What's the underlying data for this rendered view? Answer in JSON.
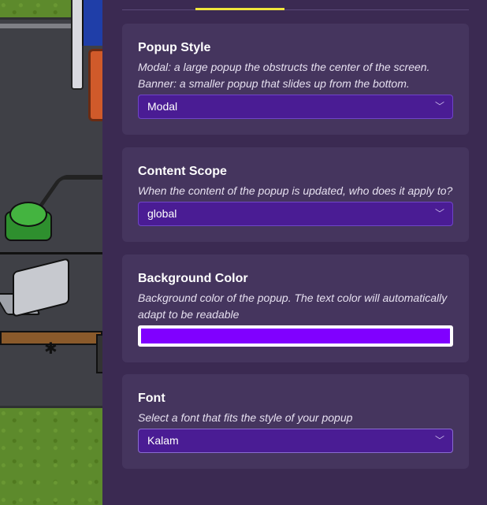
{
  "settings": {
    "popup_style": {
      "title": "Popup Style",
      "description_line1": "Modal: a large popup the obstructs the center of the screen.",
      "description_line2": "Banner: a smaller popup that slides up from the bottom.",
      "value": "Modal"
    },
    "content_scope": {
      "title": "Content Scope",
      "description": "When the content of the popup is updated, who does it apply to?",
      "value": "global"
    },
    "background_color": {
      "title": "Background Color",
      "description_line1": "Background color of the popup. The text color will automatically",
      "description_line2": "adapt to be readable",
      "color": "#8000ff"
    },
    "font": {
      "title": "Font",
      "description": "Select a font that fits the style of your popup",
      "value": "Kalam"
    }
  },
  "icons": {
    "dropdown": "chevron-down-icon"
  },
  "colors": {
    "panel_bg": "#3b2a52",
    "card_bg": "#45355e",
    "select_bg": "#4a1c94",
    "tab_indicator": "#f0e53c"
  }
}
